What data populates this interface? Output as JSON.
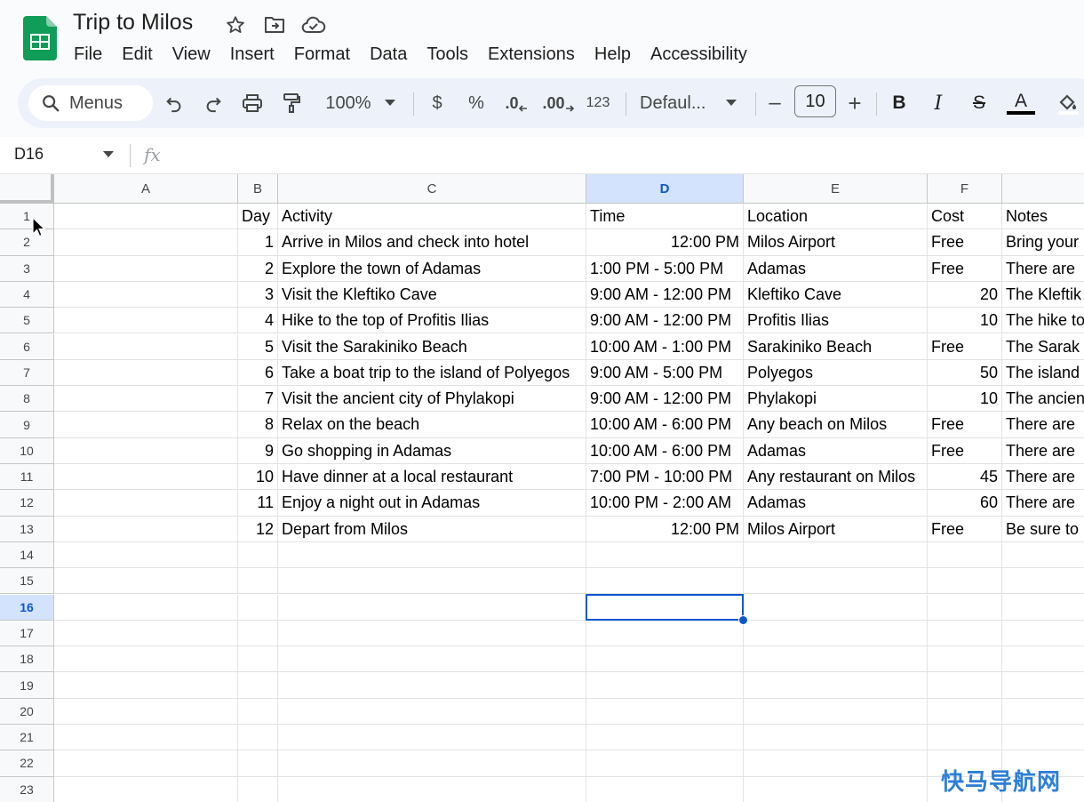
{
  "doc": {
    "title": "Trip to Milos"
  },
  "menu": [
    "File",
    "Edit",
    "View",
    "Insert",
    "Format",
    "Data",
    "Tools",
    "Extensions",
    "Help",
    "Accessibility"
  ],
  "toolbar": {
    "search_label": "Menus",
    "zoom": "100%",
    "currency": "$",
    "percent": "%",
    "dec_decrease": ".0",
    "dec_increase": ".00",
    "format_123": "123",
    "font": "Defaul...",
    "minus": "–",
    "font_size": "10",
    "plus": "+",
    "bold": "B",
    "italic": "I",
    "strike": "S",
    "text_color": "A"
  },
  "formula": {
    "cell_ref": "D16",
    "fx": "fx"
  },
  "columns": [
    "A",
    "B",
    "C",
    "D",
    "E",
    "F",
    ""
  ],
  "selected_column": "D",
  "selected_row": 16,
  "rows": [
    "1",
    "2",
    "3",
    "4",
    "5",
    "6",
    "7",
    "8",
    "9",
    "10",
    "11",
    "12",
    "13",
    "14",
    "15",
    "16",
    "17",
    "18",
    "19",
    "20",
    "21",
    "22",
    "23"
  ],
  "table": [
    [
      "",
      "Day",
      "Activity",
      "Time",
      "Location",
      "Cost",
      "Notes"
    ],
    [
      "",
      "1",
      "Arrive in Milos and check into hotel",
      "12:00 PM",
      "Milos Airport",
      "Free",
      "Bring your"
    ],
    [
      "",
      "2",
      "Explore the town of Adamas",
      "1:00 PM - 5:00 PM",
      "Adamas",
      "Free",
      "There are"
    ],
    [
      "",
      "3",
      "Visit the Kleftiko Cave",
      "9:00 AM - 12:00 PM",
      "Kleftiko Cave",
      "20",
      "The Kleftik"
    ],
    [
      "",
      "4",
      "Hike to the top of Profitis Ilias",
      "9:00 AM - 12:00 PM",
      "Profitis Ilias",
      "10",
      "The hike to"
    ],
    [
      "",
      "5",
      "Visit the Sarakiniko Beach",
      "10:00 AM - 1:00 PM",
      "Sarakiniko Beach",
      "Free",
      "The Sarak"
    ],
    [
      "",
      "6",
      "Take a boat trip to the island of Polyegos",
      "9:00 AM - 5:00 PM",
      "Polyegos",
      "50",
      "The island"
    ],
    [
      "",
      "7",
      "Visit the ancient city of Phylakopi",
      "9:00 AM - 12:00 PM",
      "Phylakopi",
      "10",
      "The ancien"
    ],
    [
      "",
      "8",
      "Relax on the beach",
      "10:00 AM - 6:00 PM",
      "Any beach on Milos",
      "Free",
      "There are"
    ],
    [
      "",
      "9",
      "Go shopping in Adamas",
      "10:00 AM - 6:00 PM",
      "Adamas",
      "Free",
      "There are"
    ],
    [
      "",
      "10",
      "Have dinner at a local restaurant",
      "7:00 PM - 10:00 PM",
      "Any restaurant on Milos",
      "45",
      "There are"
    ],
    [
      "",
      "11",
      "Enjoy a night out in Adamas",
      "10:00 PM - 2:00 AM",
      "Adamas",
      "60",
      "There are"
    ],
    [
      "",
      "12",
      "Depart from Milos",
      "12:00 PM",
      "Milos Airport",
      "Free",
      "Be sure to"
    ]
  ],
  "watermark": "快马导航网",
  "colors": {
    "accent": "#0b57d0",
    "sheets_green": "#0f9d58",
    "selected_header": "#d3e3fd"
  }
}
